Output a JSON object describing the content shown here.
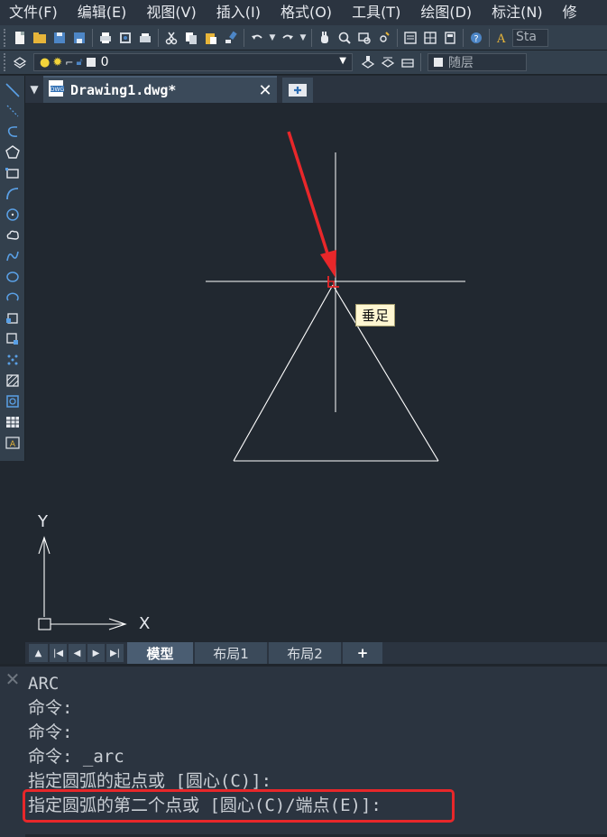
{
  "menubar": {
    "items": [
      "文件(F)",
      "编辑(E)",
      "视图(V)",
      "插入(I)",
      "格式(O)",
      "工具(T)",
      "绘图(D)",
      "标注(N)",
      "修"
    ]
  },
  "toolbar": {
    "text_style": "Sta"
  },
  "layer_bar": {
    "current_layer": "0",
    "color_value": "随层"
  },
  "document_tab": {
    "title": "Drawing1.dwg*"
  },
  "canvas": {
    "snap_tooltip": "垂足",
    "ucs_x_label": "X",
    "ucs_y_label": "Y",
    "line_color": "#ffffff",
    "arrow_color": "#e8272a",
    "snap_marker_color": "#e8272a"
  },
  "layout_tabs": {
    "tabs": [
      "模型",
      "布局1",
      "布局2"
    ],
    "active": "模型",
    "add_label": "+"
  },
  "command_history": {
    "lines": [
      "ARC",
      "命令:",
      "命令:",
      "命令: _arc",
      "指定圆弧的起点或 [圆心(C)]:",
      "指定圆弧的第二个点或 [圆心(C)/端点(E)]:"
    ],
    "highlight_color": "#e8272a"
  }
}
